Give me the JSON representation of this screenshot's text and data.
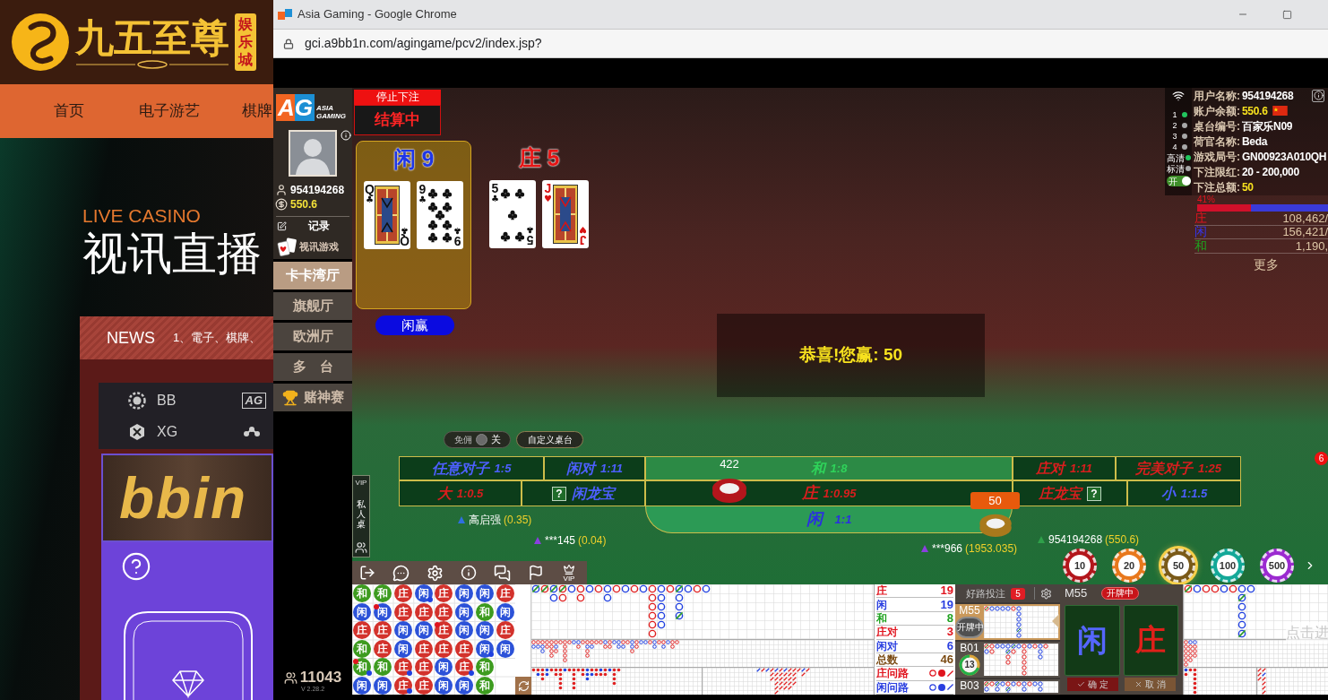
{
  "site": {
    "logo_text": "九五至尊",
    "logo_badge": "娱乐城",
    "nav": [
      {
        "label": "首页"
      },
      {
        "label": "电子游艺"
      },
      {
        "label": "棋牌"
      }
    ],
    "hero_kicker": "LIVE CASINO",
    "hero_title": "视讯直播",
    "news_label": "NEWS",
    "news_ticker": "1、電子、棋牌、",
    "providers": [
      {
        "label": "BB",
        "kind": "bb"
      },
      {
        "label": "XG",
        "kind": "xg"
      }
    ],
    "provider_logo": "AG",
    "banner_logo": "bbin"
  },
  "browser": {
    "title": "Asia Gaming - Google Chrome",
    "url": "gci.a9bb1n.com/agingame/pcv2/index.jsp?"
  },
  "sidebar": {
    "brand": "AG",
    "brand_sub": "ASIA GAMING",
    "user_id": "954194268",
    "balance": "550.6",
    "links": [
      {
        "label": "记录",
        "kind": "record"
      },
      {
        "label": "视讯游戏",
        "kind": "cards"
      }
    ],
    "halls": [
      {
        "label": "卡卡湾厅",
        "selected": true,
        "kind": "plain"
      },
      {
        "label": "旗舰厅",
        "selected": false,
        "kind": "plain"
      },
      {
        "label": "欧洲厅",
        "selected": false,
        "kind": "plain"
      },
      {
        "label": "多　台",
        "selected": false,
        "kind": "plain"
      },
      {
        "label": "赌神赛",
        "selected": false,
        "kind": "trophy"
      }
    ],
    "online": "11043",
    "version": "V 2.28.2"
  },
  "round": {
    "stop_label": "停止下注",
    "status": "结算中",
    "hands": [
      {
        "label": "闲 9",
        "kind": "player",
        "winner": true,
        "cards": [
          {
            "rank": "Q",
            "suit": "♣",
            "rank_rotated": "Q",
            "suit_rotated": "♣",
            "kind": "face",
            "color": "#111111"
          },
          {
            "rank": "9",
            "suit": "♣",
            "rank_rotated": "9",
            "suit_rotated": "♣",
            "kind": "nine",
            "color": "#111111"
          }
        ]
      },
      {
        "label": "庄 5",
        "kind": "banker",
        "winner": false,
        "cards": [
          {
            "rank": "5",
            "suit": "♣",
            "rank_rotated": "5",
            "suit_rotated": "♣",
            "kind": "five",
            "color": "#111111"
          },
          {
            "rank": "J",
            "suit": "♥",
            "rank_rotated": "J",
            "suit_rotated": "♥",
            "kind": "face",
            "color": "#d81414"
          }
        ]
      }
    ],
    "result": "闲赢",
    "win_message": "恭喜!您赢: 50"
  },
  "table": {
    "commission": {
      "label": "免佣",
      "value": "关",
      "on": false
    },
    "custom_label": "自定义桌台",
    "bets_top": [
      {
        "label": "任意对子",
        "odds": "1:5",
        "kind": "player"
      },
      {
        "label": "闲对",
        "odds": "1:11",
        "kind": "player"
      },
      {
        "label": "和",
        "odds": "1:8",
        "kind": "tie"
      },
      {
        "label": "庄对",
        "odds": "1:11",
        "kind": "banker"
      },
      {
        "label": "完美对子",
        "odds": "1:25",
        "kind": "banker"
      }
    ],
    "bets_middle": [
      {
        "label": "大",
        "odds": "1:0.5",
        "kind": "banker"
      },
      {
        "label": "闲龙宝",
        "help": "?",
        "kind": "player"
      },
      {
        "label": "庄",
        "odds": "1:0.95",
        "kind": "banker"
      },
      {
        "label": "庄龙宝",
        "help": "?",
        "kind": "banker"
      },
      {
        "label": "小",
        "odds": "1:1.5",
        "kind": "player"
      }
    ],
    "bet_player": {
      "label": "闲",
      "odds": "1:1",
      "kind": "player"
    },
    "stacks": [
      {
        "amount": "422",
        "kind": "plain",
        "color": "#b4161c"
      },
      {
        "amount": "50",
        "kind": "badge",
        "color": "#a8791c"
      }
    ],
    "players": [
      {
        "name": "高启强",
        "amount": "(0.35)",
        "color": "#2f6fe0"
      },
      {
        "name": "***145",
        "amount": "(0.04)",
        "color": "#8b3fe0"
      },
      {
        "name": "***966",
        "amount": "(1953.035)",
        "color": "#8b3fe0"
      },
      {
        "name": "954194268",
        "amount": "(550.6)",
        "color": "#2fa04a"
      }
    ],
    "chips": [
      {
        "label": "10",
        "color": "#b3161c",
        "selected": false
      },
      {
        "label": "20",
        "color": "#e8781c",
        "selected": false
      },
      {
        "label": "50",
        "color": "#7a5a18",
        "selected": true
      },
      {
        "label": "100",
        "color": "#14a898",
        "selected": false
      },
      {
        "label": "500",
        "color": "#9b2ad0",
        "selected": false
      }
    ],
    "side_tab": {
      "vip": "VIP",
      "label": "私人桌"
    },
    "toolbar_vip": "VIP",
    "notice_count": "6"
  },
  "info": {
    "rows": [
      {
        "label": "用户名称:",
        "value": "954194268",
        "highlight": false,
        "kind": "user"
      },
      {
        "label": "账户余额:",
        "value": "550.6",
        "highlight": true,
        "kind": "balance"
      },
      {
        "label": "桌台编号:",
        "value": "百家乐N09",
        "highlight": false,
        "kind": "plain"
      },
      {
        "label": "荷官名称:",
        "value": "Beda",
        "highlight": false,
        "kind": "plain"
      },
      {
        "label": "游戏局号:",
        "value": "GN00923A010QH",
        "highlight": false,
        "kind": "plain"
      },
      {
        "label": "下注限红:",
        "value": "20 - 200,000",
        "highlight": false,
        "kind": "plain"
      },
      {
        "label": "下注总额:",
        "value": "50",
        "highlight": true,
        "kind": "plain"
      }
    ],
    "lines": [
      {
        "label": "1",
        "selected": true
      },
      {
        "label": "2",
        "selected": false
      },
      {
        "label": "3",
        "selected": false
      },
      {
        "label": "4",
        "selected": false
      }
    ],
    "quality": [
      {
        "label": "高清",
        "selected": true
      },
      {
        "label": "标清",
        "selected": false
      }
    ],
    "toggle": {
      "label": "开",
      "on": true
    },
    "bet_split": {
      "percent": "41%",
      "level": 0.41
    },
    "totals": [
      {
        "label": "庄",
        "value": "108,462/",
        "color": "#e0141e"
      },
      {
        "label": "闲",
        "value": "156,421/",
        "color": "#3535f0"
      },
      {
        "label": "和",
        "value": "1,190,",
        "color": "#1fa21f"
      }
    ],
    "more": "更多"
  },
  "roadmap": {
    "bead_rows": [
      [
        {
          "label": "和",
          "kind": "tie",
          "banker_pair": false,
          "player_pair": false
        },
        {
          "label": "和",
          "kind": "tie",
          "banker_pair": false,
          "player_pair": false
        },
        {
          "label": "庄",
          "kind": "banker",
          "banker_pair": false,
          "player_pair": false
        },
        {
          "label": "闲",
          "kind": "player",
          "banker_pair": false,
          "player_pair": true
        },
        {
          "label": "庄",
          "kind": "banker",
          "banker_pair": false,
          "player_pair": false
        },
        {
          "label": "闲",
          "kind": "player",
          "banker_pair": false,
          "player_pair": false
        },
        {
          "label": "闲",
          "kind": "player",
          "banker_pair": false,
          "player_pair": false
        },
        {
          "label": "庄",
          "kind": "banker",
          "banker_pair": false,
          "player_pair": false
        }
      ],
      [
        {
          "label": "闲",
          "kind": "player",
          "banker_pair": false,
          "player_pair": false
        },
        {
          "label": "闲",
          "kind": "player",
          "banker_pair": true,
          "player_pair": false
        },
        {
          "label": "庄",
          "kind": "banker",
          "banker_pair": false,
          "player_pair": false
        },
        {
          "label": "庄",
          "kind": "banker",
          "banker_pair": false,
          "player_pair": false
        },
        {
          "label": "庄",
          "kind": "banker",
          "banker_pair": false,
          "player_pair": false
        },
        {
          "label": "闲",
          "kind": "player",
          "banker_pair": false,
          "player_pair": false
        },
        {
          "label": "和",
          "kind": "tie",
          "banker_pair": false,
          "player_pair": false
        },
        {
          "label": "闲",
          "kind": "player",
          "banker_pair": false,
          "player_pair": false
        }
      ],
      [
        {
          "label": "庄",
          "kind": "banker",
          "banker_pair": false,
          "player_pair": false
        },
        {
          "label": "庄",
          "kind": "banker",
          "banker_pair": false,
          "player_pair": false
        },
        {
          "label": "闲",
          "kind": "player",
          "banker_pair": false,
          "player_pair": false
        },
        {
          "label": "闲",
          "kind": "player",
          "banker_pair": false,
          "player_pair": false
        },
        {
          "label": "庄",
          "kind": "banker",
          "banker_pair": true,
          "player_pair": false
        },
        {
          "label": "闲",
          "kind": "player",
          "banker_pair": false,
          "player_pair": false
        },
        {
          "label": "闲",
          "kind": "player",
          "banker_pair": false,
          "player_pair": false
        },
        {
          "label": "庄",
          "kind": "banker",
          "banker_pair": false,
          "player_pair": false
        }
      ],
      [
        {
          "label": "和",
          "kind": "tie",
          "banker_pair": false,
          "player_pair": false
        },
        {
          "label": "庄",
          "kind": "banker",
          "banker_pair": false,
          "player_pair": false
        },
        {
          "label": "闲",
          "kind": "player",
          "banker_pair": false,
          "player_pair": false
        },
        {
          "label": "庄",
          "kind": "banker",
          "banker_pair": false,
          "player_pair": false
        },
        {
          "label": "庄",
          "kind": "banker",
          "banker_pair": false,
          "player_pair": false
        },
        {
          "label": "庄",
          "kind": "banker",
          "banker_pair": false,
          "player_pair": false
        },
        {
          "label": "闲",
          "kind": "player",
          "banker_pair": false,
          "player_pair": true
        },
        {
          "label": "闲",
          "kind": "player",
          "banker_pair": false,
          "player_pair": false
        }
      ],
      [
        {
          "label": "和",
          "kind": "tie",
          "banker_pair": true,
          "player_pair": true
        },
        {
          "label": "和",
          "kind": "tie",
          "banker_pair": false,
          "player_pair": false
        },
        {
          "label": "庄",
          "kind": "banker",
          "banker_pair": false,
          "player_pair": true
        },
        {
          "label": "庄",
          "kind": "banker",
          "banker_pair": false,
          "player_pair": false
        },
        {
          "label": "闲",
          "kind": "player",
          "banker_pair": false,
          "player_pair": false
        },
        {
          "label": "庄",
          "kind": "banker",
          "banker_pair": false,
          "player_pair": true
        },
        {
          "label": "和",
          "kind": "tie",
          "banker_pair": false,
          "player_pair": false
        }
      ],
      [
        {
          "label": "闲",
          "kind": "player",
          "banker_pair": false,
          "player_pair": false
        },
        {
          "label": "闲",
          "kind": "player",
          "banker_pair": false,
          "player_pair": false
        },
        {
          "label": "庄",
          "kind": "banker",
          "banker_pair": false,
          "player_pair": true
        },
        {
          "label": "庄",
          "kind": "banker",
          "banker_pair": false,
          "player_pair": false
        },
        {
          "label": "闲",
          "kind": "player",
          "banker_pair": false,
          "player_pair": false
        },
        {
          "label": "闲",
          "kind": "player",
          "banker_pair": false,
          "player_pair": false
        },
        {
          "label": "和",
          "kind": "tie",
          "banker_pair": false,
          "player_pair": false
        }
      ]
    ],
    "stats": [
      {
        "label": "庄",
        "value": "19",
        "color": "#e0141e"
      },
      {
        "label": "闲",
        "value": "19",
        "color": "#2a3fe0"
      },
      {
        "label": "和",
        "value": "8",
        "color": "#1fa21f"
      },
      {
        "label": "庄对",
        "value": "3",
        "color": "#e0141e"
      },
      {
        "label": "闲对",
        "value": "6",
        "color": "#2a3fe0"
      },
      {
        "label": "总数",
        "value": "46",
        "color": "#7a4a12"
      }
    ],
    "ask": [
      {
        "label": "庄问路",
        "color": "#e0141e"
      },
      {
        "label": "闲问路",
        "color": "#2a3fe0"
      }
    ]
  },
  "good_roads": {
    "title": "好路投注",
    "count": "5",
    "tables": [
      {
        "name": "M55",
        "selected": true,
        "kind": "status",
        "status": "开牌中"
      },
      {
        "name": "B01",
        "selected": false,
        "kind": "timer",
        "timer": "13"
      },
      {
        "name": "B03",
        "selected": false,
        "kind": "plain"
      }
    ]
  },
  "quick_bet": {
    "table": "M55",
    "status": "开牌中",
    "options": [
      {
        "label": "闲",
        "kind": "player"
      },
      {
        "label": "庄",
        "kind": "banker"
      }
    ],
    "confirm": "确 定",
    "cancel": "取 消"
  },
  "right_road": {
    "hint": "点击进"
  }
}
